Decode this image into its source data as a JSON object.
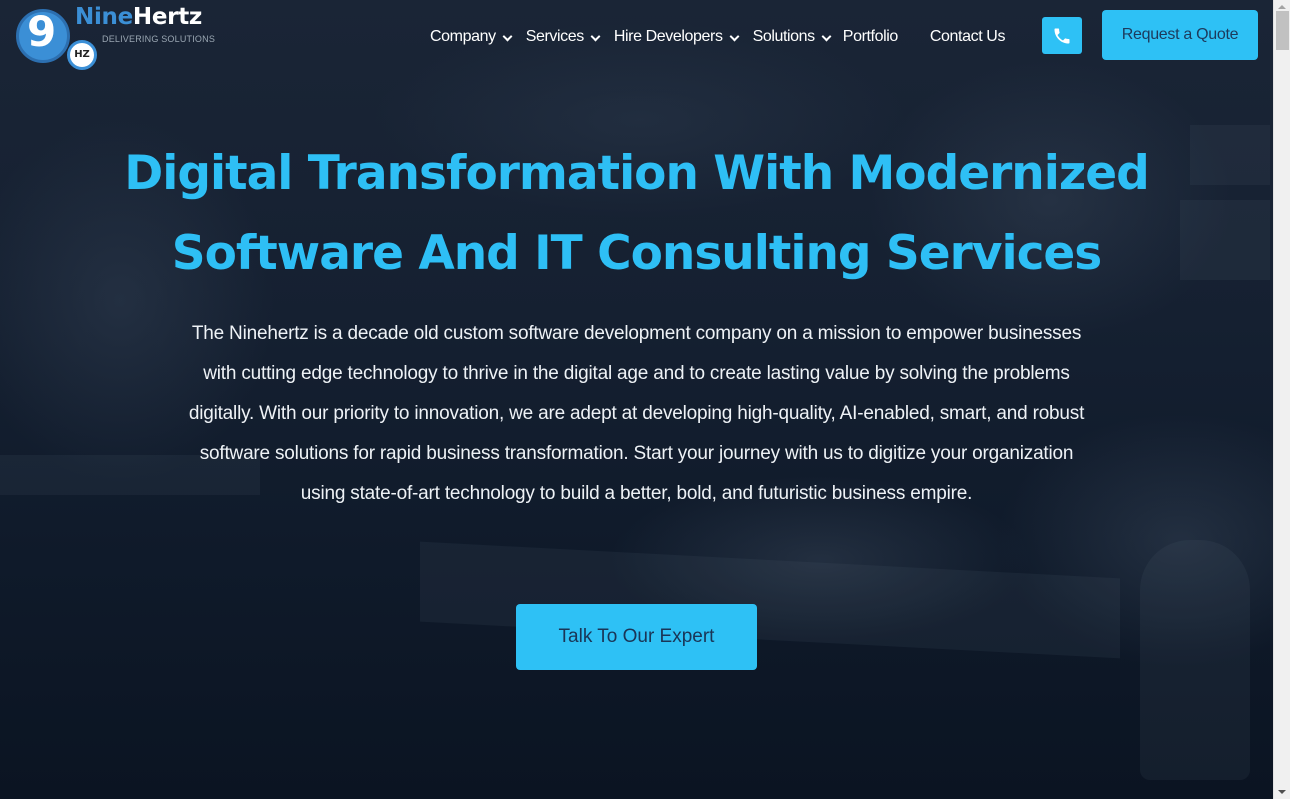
{
  "logo": {
    "nine_glyph": "9",
    "badge": "HZ",
    "name_part1": "Nine",
    "name_part2": "Hertz",
    "tagline": "DELIVERING SOLUTIONS"
  },
  "nav": {
    "items": [
      {
        "label": "Company",
        "has_dropdown": true
      },
      {
        "label": "Services",
        "has_dropdown": true
      },
      {
        "label": "Hire Developers",
        "has_dropdown": true
      },
      {
        "label": "Solutions",
        "has_dropdown": true
      },
      {
        "label": "Portfolio",
        "has_dropdown": false
      },
      {
        "label": "Contact Us",
        "has_dropdown": false
      }
    ],
    "phone_icon": "phone-icon",
    "quote_label": "Request a Quote"
  },
  "hero": {
    "title_line1": "Digital Transformation With Modernized",
    "title_line2": "Software And IT Consulting Services",
    "description": "The Ninehertz is a decade old custom software development company on a mission to empower businesses with cutting edge technology to thrive in the digital age and to create lasting value by solving the problems digitally. With our priority to innovation, we are adept at developing high-quality, AI-enabled, smart, and robust software solutions for rapid business transformation. Start your journey with us to digitize your organization using state-of-art technology to build a better, bold, and futuristic business empire.",
    "cta_label": "Talk To Our Expert"
  },
  "colors": {
    "accent": "#2ec1f5",
    "logo_blue": "#3b8fd6",
    "button_text": "#1d3a5c",
    "background": "#131d2d"
  }
}
